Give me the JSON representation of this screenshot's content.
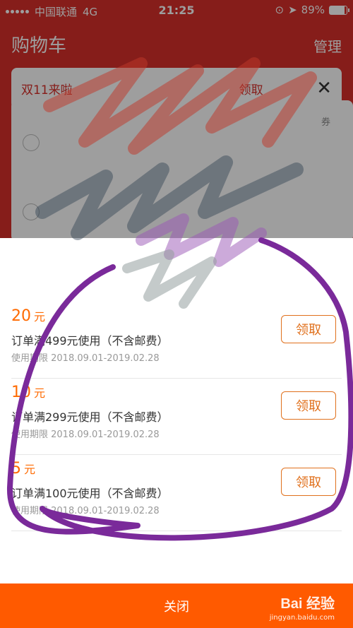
{
  "status_bar": {
    "carrier": "中国联通",
    "network": "4G",
    "time": "21:25",
    "battery": "89%",
    "battery_level": 0.89
  },
  "header": {
    "title": "购物车",
    "manage": "管理"
  },
  "notice": {
    "text": "双11来啦",
    "suffix": "领取",
    "close_icon": "close-icon"
  },
  "coupon_tag": "券",
  "coupons": [
    {
      "amount": "20",
      "unit": "元",
      "condition": "订单满499元使用（不含邮费）",
      "period": "使用期限 2018.09.01-2019.02.28",
      "action": "领取"
    },
    {
      "amount": "10",
      "unit": "元",
      "condition": "订单满299元使用（不含邮费）",
      "period": "使用期限 2018.09.01-2019.02.28",
      "action": "领取"
    },
    {
      "amount": "5",
      "unit": "元",
      "condition": "订单满100元使用（不含邮费）",
      "period": "使用期限 2018.09.01-2019.02.28",
      "action": "领取"
    }
  ],
  "bottom_bar": {
    "close": "关闭"
  },
  "watermark": {
    "brand": "Bai 经验",
    "site": "jingyan.baidu.com"
  },
  "colors": {
    "brand_red": "#d8302a",
    "accent_orange": "#ff5a00",
    "claim_orange": "#e0701c",
    "annotation_purple": "#7a2a9a"
  }
}
